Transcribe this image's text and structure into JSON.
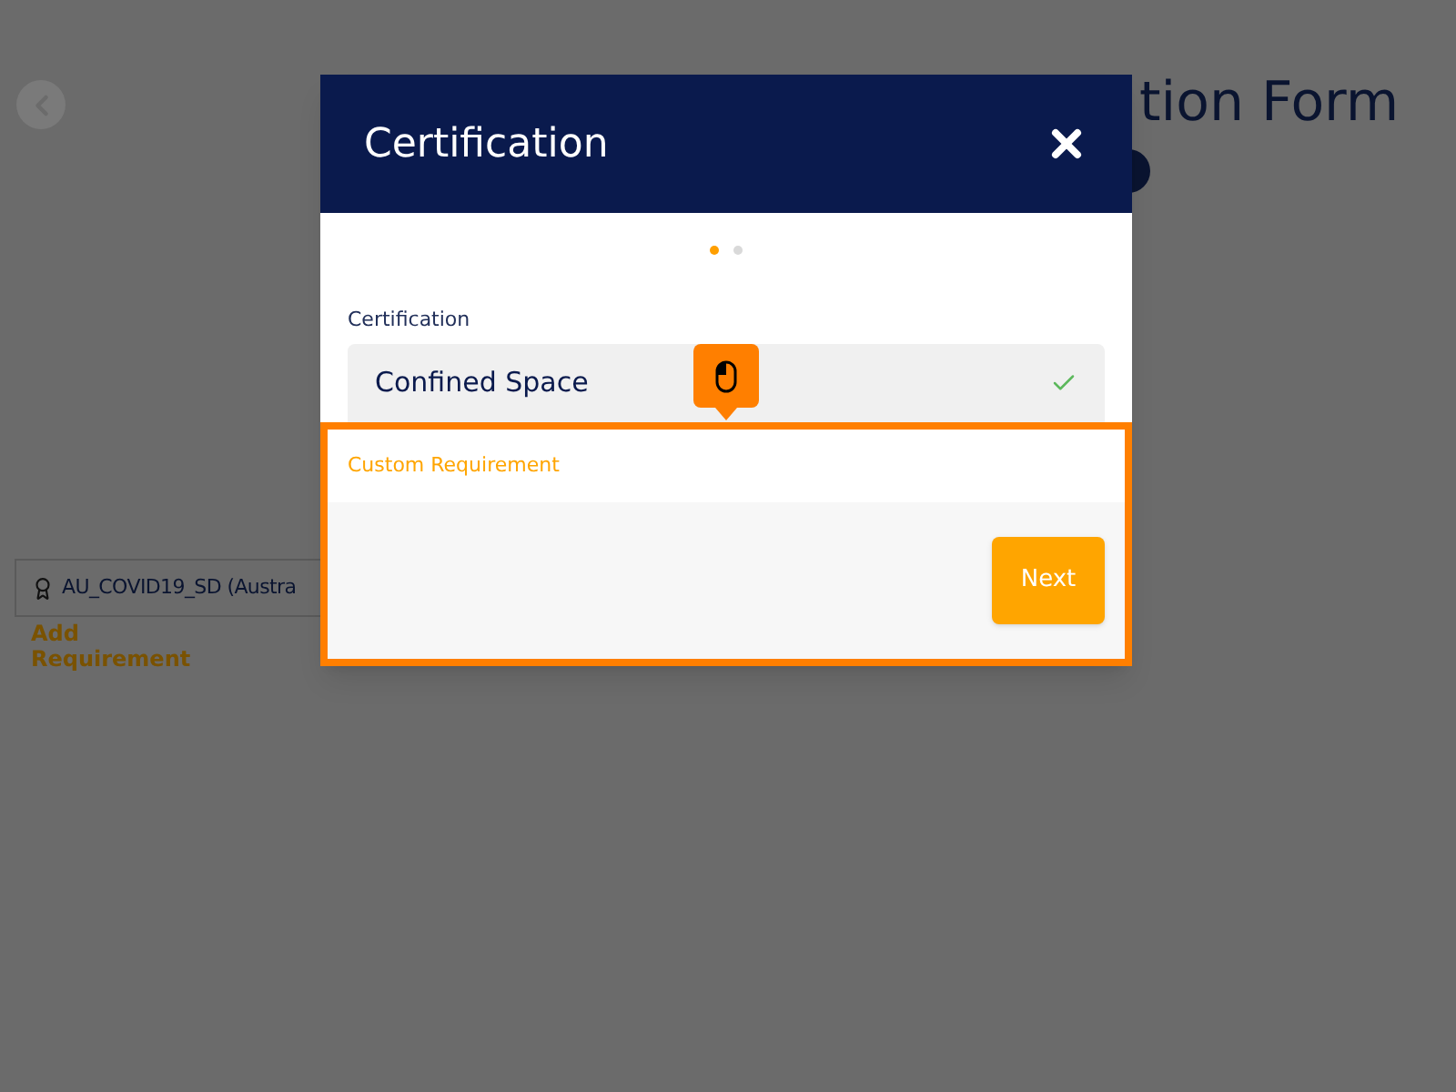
{
  "background": {
    "title": "tion Form",
    "card": {
      "label": "AU_COVID19_SD (Austra"
    },
    "add_link": "Add Requirement"
  },
  "modal": {
    "title": "Certification",
    "pager": [
      {
        "selected": true
      },
      {
        "selected": false
      }
    ],
    "field": {
      "label": "Certification",
      "value": "Confined Space",
      "valid": true
    },
    "custom_label": "Custom Requirement",
    "next_button": "Next"
  }
}
